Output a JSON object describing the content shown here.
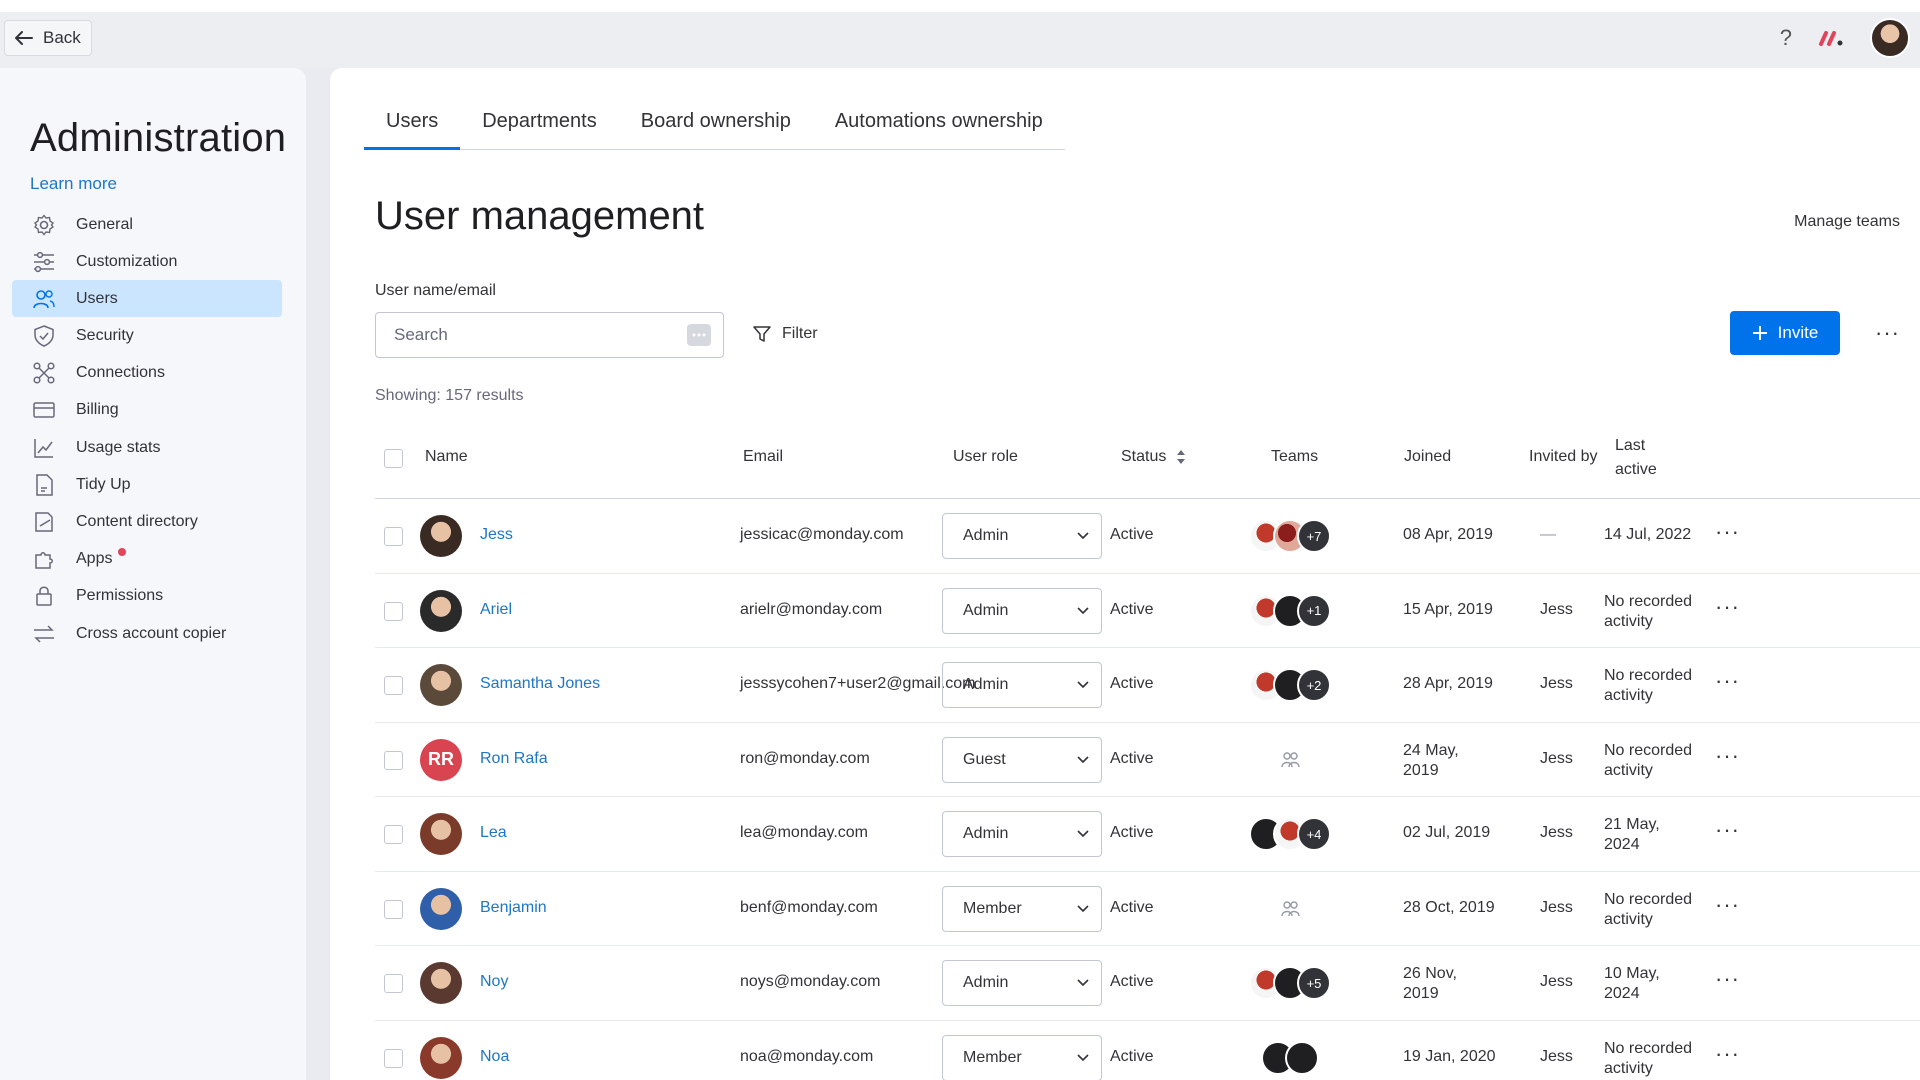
{
  "topbar": {
    "back_label": "Back",
    "help": "?"
  },
  "sidebar": {
    "title": "Administration",
    "learn_more": "Learn more",
    "items": [
      {
        "label": "General",
        "icon": "gear-icon"
      },
      {
        "label": "Customization",
        "icon": "sliders-icon"
      },
      {
        "label": "Users",
        "icon": "users-icon",
        "active": true
      },
      {
        "label": "Security",
        "icon": "shield-icon"
      },
      {
        "label": "Connections",
        "icon": "connections-icon"
      },
      {
        "label": "Billing",
        "icon": "credit-card-icon"
      },
      {
        "label": "Usage stats",
        "icon": "chart-icon"
      },
      {
        "label": "Tidy Up",
        "icon": "document-icon"
      },
      {
        "label": "Content directory",
        "icon": "folder-icon"
      },
      {
        "label": "Apps",
        "icon": "puzzle-icon",
        "notification": true
      },
      {
        "label": "Permissions",
        "icon": "lock-icon"
      },
      {
        "label": "Cross account copier",
        "icon": "swap-icon"
      }
    ]
  },
  "main": {
    "tabs": [
      {
        "label": "Users"
      },
      {
        "label": "Departments"
      },
      {
        "label": "Board ownership"
      },
      {
        "label": "Automations ownership"
      }
    ],
    "title": "User management",
    "manage_teams": "Manage teams",
    "search_label": "User name/email",
    "search_placeholder": "Search",
    "filter_label": "Filter",
    "invite_label": "Invite",
    "more": "···",
    "showing": "Showing: 157 results",
    "columns": {
      "name": "Name",
      "email": "Email",
      "role": "User role",
      "status": "Status",
      "teams": "Teams",
      "joined": "Joined",
      "invited_by": "Invited by",
      "last_active": "Last active"
    },
    "rows": [
      {
        "name": "Jess",
        "email": "jessicac@monday.com",
        "role": "Admin",
        "status": "Active",
        "teams": [
          "cup",
          "cup2"
        ],
        "teams_more": "+7",
        "joined": "08 Apr, 2019",
        "invited_by": "—",
        "last_active": "14 Jul, 2022",
        "avatar": "photo"
      },
      {
        "name": "Ariel",
        "email": "arielr@monday.com",
        "role": "Admin",
        "status": "Active",
        "teams": [
          "cup",
          "mickey"
        ],
        "teams_more": "+1",
        "joined": "15 Apr, 2019",
        "invited_by": "Jess",
        "last_active": "No recorded activity",
        "avatar": "photo"
      },
      {
        "name": "Samantha Jones",
        "email": "jesssycohen7+user2@gmail.com",
        "role": "Admin",
        "status": "Active",
        "teams": [
          "cup",
          "mickey"
        ],
        "teams_more": "+2",
        "joined": "28 Apr, 2019",
        "invited_by": "Jess",
        "last_active": "No recorded activity",
        "avatar": "photo"
      },
      {
        "name": "Ron Rafa",
        "email": "ron@monday.com",
        "role": "Guest",
        "status": "Active",
        "teams": [],
        "teams_more": "",
        "joined": "24 May, 2019",
        "invited_by": "Jess",
        "last_active": "No recorded activity",
        "avatar": "initials",
        "initials": "RR"
      },
      {
        "name": "Lea",
        "email": "lea@monday.com",
        "role": "Admin",
        "status": "Active",
        "teams": [
          "mickey",
          "cup"
        ],
        "teams_more": "+4",
        "joined": "02 Jul, 2019",
        "invited_by": "Jess",
        "last_active": "21 May, 2024",
        "avatar": "photo"
      },
      {
        "name": "Benjamin",
        "email": "benf@monday.com",
        "role": "Member",
        "status": "Active",
        "teams": [],
        "teams_more": "",
        "joined": "28 Oct, 2019",
        "invited_by": "Jess",
        "last_active": "No recorded activity",
        "avatar": "photo"
      },
      {
        "name": "Noy",
        "email": "noys@monday.com",
        "role": "Admin",
        "status": "Active",
        "teams": [
          "cup",
          "mickey"
        ],
        "teams_more": "+5",
        "joined": "26 Nov, 2019",
        "invited_by": "Jess",
        "last_active": "10 May, 2024",
        "avatar": "photo"
      },
      {
        "name": "Noa",
        "email": "noa@monday.com",
        "role": "Member",
        "status": "Active",
        "teams": [
          "mickey",
          "mickey"
        ],
        "teams_more": "",
        "joined": "19 Jan, 2020",
        "invited_by": "Jess",
        "last_active": "No recorded activity",
        "avatar": "photo"
      }
    ]
  },
  "colors": {
    "accent": "#0073ea",
    "link": "#1f76c2",
    "active_nav": "#cce5ff",
    "notification": "#e2445c",
    "initials_avatar": "#d8444f"
  }
}
